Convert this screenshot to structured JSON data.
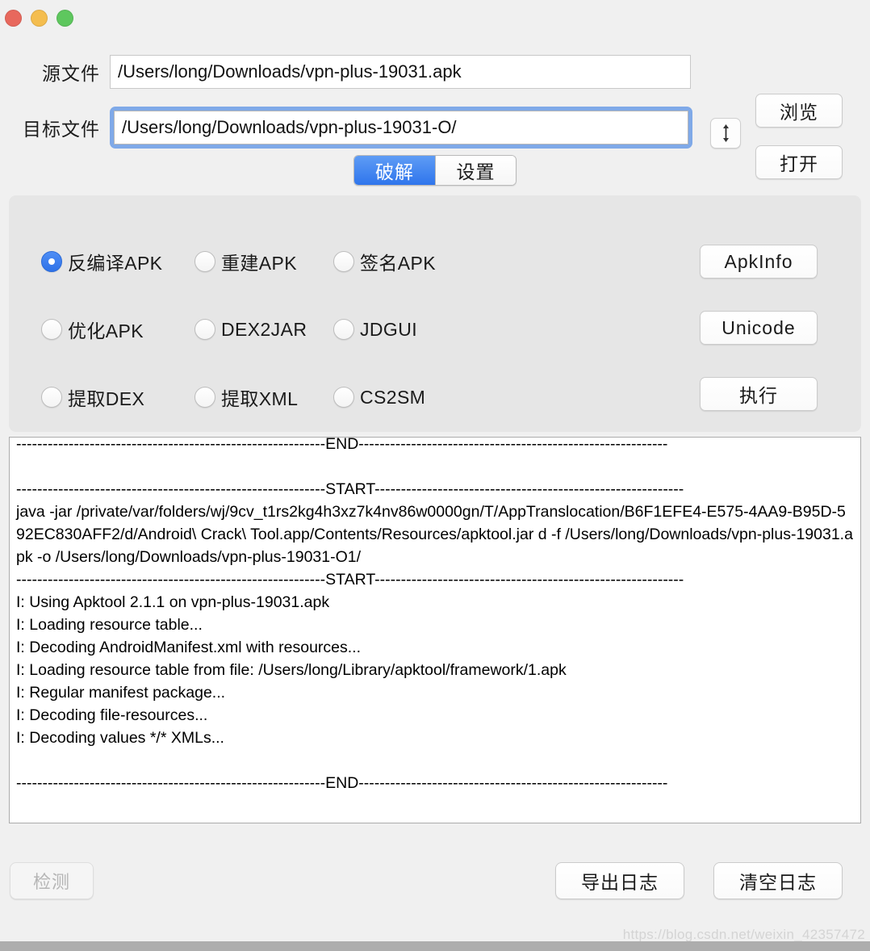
{
  "window": {
    "traffic_lights": [
      {
        "name": "close",
        "color": "#E8685D"
      },
      {
        "name": "minimize",
        "color": "#F4BD4E"
      },
      {
        "name": "maximize",
        "color": "#5EC75E"
      }
    ]
  },
  "paths": {
    "source": {
      "label": "源文件",
      "value": "/Users/long/Downloads/vpn-plus-19031.apk",
      "focused": false
    },
    "target": {
      "label": "目标文件",
      "value": "/Users/long/Downloads/vpn-plus-19031-O/",
      "focused": true
    },
    "swap_icon": "swap-vertical-icon",
    "browse_label": "浏览",
    "open_label": "打开"
  },
  "tabs": [
    {
      "label": "破解",
      "active": true
    },
    {
      "label": "设置",
      "active": false
    }
  ],
  "options": {
    "rows": [
      [
        {
          "label": "反编译APK",
          "checked": true
        },
        {
          "label": "重建APK",
          "checked": false
        },
        {
          "label": "签名APK",
          "checked": false
        }
      ],
      [
        {
          "label": "优化APK",
          "checked": false
        },
        {
          "label": "DEX2JAR",
          "checked": false
        },
        {
          "label": "JDGUI",
          "checked": false
        }
      ],
      [
        {
          "label": "提取DEX",
          "checked": false
        },
        {
          "label": "提取XML",
          "checked": false
        },
        {
          "label": "CS2SM",
          "checked": false
        }
      ]
    ],
    "actions": {
      "apkinfo": "ApkInfo",
      "unicode": "Unicode",
      "execute": "执行"
    }
  },
  "log": {
    "content": "-----------------------------------------------------------END-----------------------------------------------------------\n\n-----------------------------------------------------------START-----------------------------------------------------------\njava -jar /private/var/folders/wj/9cv_t1rs2kg4h3xz7k4nv86w0000gn/T/AppTranslocation/B6F1EFE4-E575-4AA9-B95D-592EC830AFF2/d/Android\\ Crack\\ Tool.app/Contents/Resources/apktool.jar d -f /Users/long/Downloads/vpn-plus-19031.apk -o /Users/long/Downloads/vpn-plus-19031-O1/\n-----------------------------------------------------------START-----------------------------------------------------------\nI: Using Apktool 2.1.1 on vpn-plus-19031.apk\nI: Loading resource table...\nI: Decoding AndroidManifest.xml with resources...\nI: Loading resource table from file: /Users/long/Library/apktool/framework/1.apk\nI: Regular manifest package...\nI: Decoding file-resources...\nI: Decoding values */* XMLs...\n\n-----------------------------------------------------------END-----------------------------------------------------------"
  },
  "bottom": {
    "detect_label": "检测",
    "detect_disabled": true,
    "export_label": "导出日志",
    "clear_label": "清空日志"
  },
  "watermark": {
    "text": "https://blog.csdn.net/weixin_42357472"
  },
  "colors": {
    "accent": "#2F75EC",
    "radio_selected": "#3B7EF3",
    "focus_ring": "#7FA9E8",
    "window_bg": "#F0F0F0",
    "panel_bg": "#E6E6E6"
  }
}
